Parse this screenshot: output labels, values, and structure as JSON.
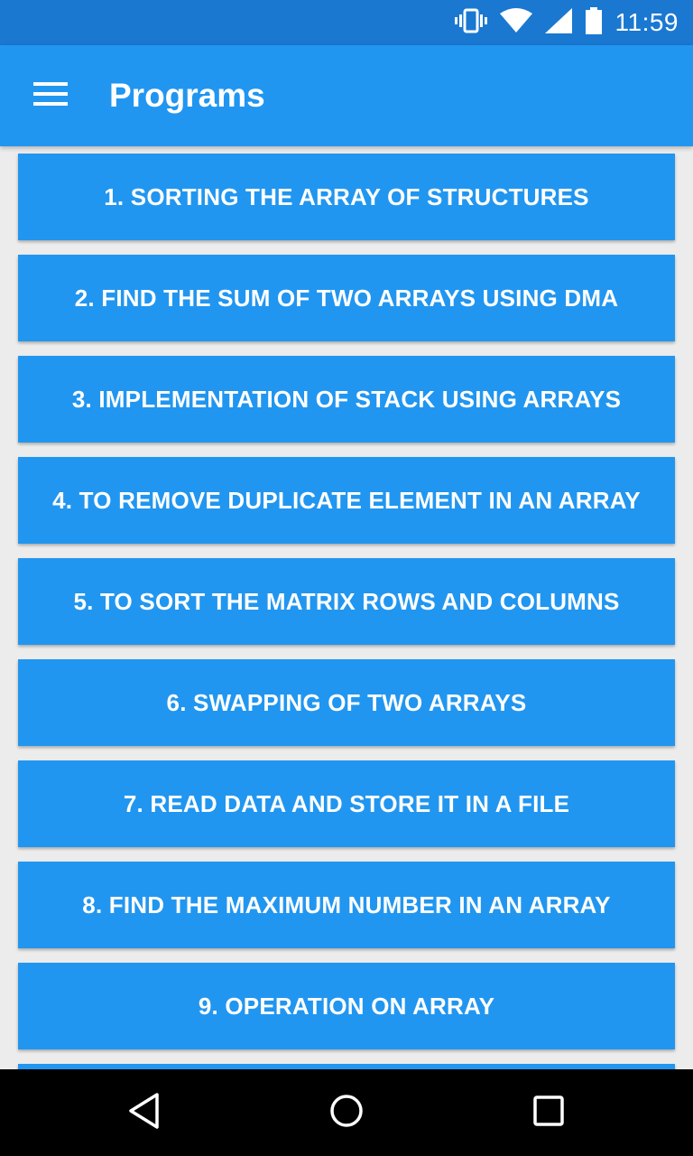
{
  "status_bar": {
    "time": "11:59",
    "icons": [
      "vibrate-icon",
      "wifi-icon",
      "cell-signal-icon",
      "battery-icon"
    ]
  },
  "app_bar": {
    "title": "Programs",
    "menu_icon": "hamburger-menu-icon"
  },
  "programs": [
    {
      "label": "1. SORTING THE ARRAY OF STRUCTURES"
    },
    {
      "label": "2. FIND THE SUM OF TWO ARRAYS USING DMA"
    },
    {
      "label": "3. IMPLEMENTATION OF STACK USING ARRAYS"
    },
    {
      "label": "4. TO REMOVE DUPLICATE ELEMENT IN AN ARRAY"
    },
    {
      "label": "5. TO SORT THE MATRIX ROWS AND COLUMNS"
    },
    {
      "label": "6. SWAPPING OF TWO ARRAYS"
    },
    {
      "label": "7. READ DATA AND STORE IT IN A FILE"
    },
    {
      "label": "8. FIND THE MAXIMUM NUMBER IN AN ARRAY"
    },
    {
      "label": "9. OPERATION ON ARRAY"
    },
    {
      "label": ""
    }
  ],
  "nav_bar": {
    "buttons": [
      "back-icon",
      "home-icon",
      "recents-icon"
    ]
  },
  "colors": {
    "status_bar": "#1a78d1",
    "app_bar": "#2196f0",
    "button": "#2196f0",
    "background": "#ececec",
    "text": "#ffffff"
  }
}
